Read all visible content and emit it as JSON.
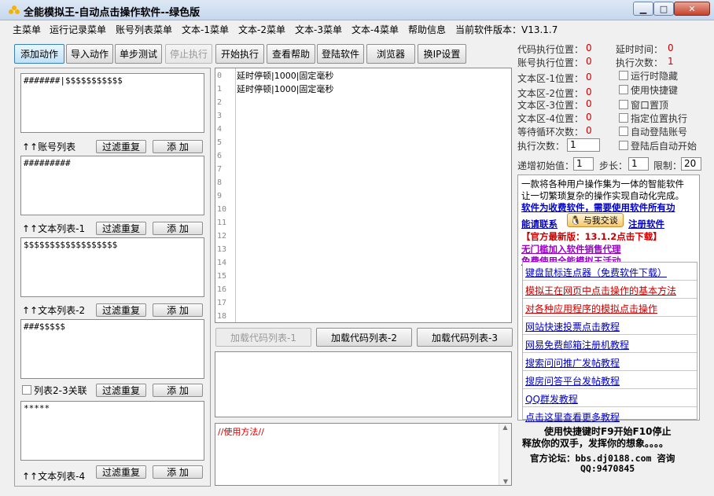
{
  "window": {
    "title": "全能模拟王-自动点击操作软件--绿色版"
  },
  "menus": [
    "主菜单",
    "运行记录菜单",
    "账号列表菜单",
    "文本-1菜单",
    "文本-2菜单",
    "文本-3菜单",
    "文本-4菜单",
    "帮助信息",
    "当前软件版本：V13.1.7"
  ],
  "toolbar": [
    "添加动作",
    "导入动作",
    "单步测试",
    "停止执行",
    "开始执行",
    "查看帮助",
    "登陆软件",
    "浏览器",
    "换IP设置"
  ],
  "left": {
    "box1": "#######|$$$$$$$$$$$",
    "box2": "#########",
    "box3": "$$$$$$$$$$$$$$$$$$",
    "box4": "###$$$$$",
    "box5": "*****",
    "label_account": "↑↑账号列表",
    "label_text1": "↑↑文本列表-1",
    "label_text2": "↑↑文本列表-2",
    "label_link": "列表2-3关联",
    "label_text4": "↑↑文本列表-4",
    "filter": "过滤重复",
    "add": "添 加"
  },
  "code": {
    "line_numbers": [
      "0",
      "1",
      "2",
      "3",
      "4",
      "5",
      "6",
      "7",
      "8",
      "9",
      "10",
      "11",
      "12",
      "13",
      "14",
      "15",
      "16",
      "17",
      "18"
    ],
    "lines": [
      "延时停顿|1000|固定毫秒",
      "延时停顿|1000|固定毫秒"
    ],
    "load1": "加载代码列表-1",
    "load2": "加载代码列表-2",
    "load3": "加载代码列表-3",
    "usage": "//使用方法//"
  },
  "status": {
    "code_pos_label": "代码执行位置：",
    "code_pos": "0",
    "delay_label": "延时时间：",
    "delay": "0",
    "account_pos_label": "账号执行位置：",
    "account_pos": "0",
    "exec_count_label": "执行次数：",
    "exec_count": "1",
    "t1_label": "文本区-1位置：",
    "t1": "0",
    "t2_label": "文本区-2位置：",
    "t2": "0",
    "t3_label": "文本区-3位置：",
    "t3": "0",
    "t4_label": "文本区-4位置：",
    "t4": "0",
    "wait_label": "等待循环次数：",
    "wait": "0",
    "exec_times_label": "执行次数：",
    "exec_times": "1",
    "inc_label": "递增初始值：",
    "inc": "1",
    "step_label": "步长：",
    "step": "1",
    "limit_label": "限制：",
    "limit": "20"
  },
  "options": [
    "运行时隐藏",
    "使用快捷键",
    "窗口置顶",
    "指定位置执行",
    "自动登陆账号",
    "登陆后自动开始"
  ],
  "info": {
    "desc1": "一款将各种用户操作集为一体的智能软件",
    "desc2": "让一切繁琐复杂的操作实现自动化完成。",
    "paid": "软件为收费软件，需要使用软件所有功",
    "contact": "能请联系",
    "qq_badge": "与我交谈",
    "register": "注册软件",
    "latest": "【官方最新版：13.1.2点击下载】",
    "agent": "无门槛加入软件销售代理",
    "free": "免费使用全能模拟王活动"
  },
  "links": [
    {
      "text": "键盘鼠标连点器（免费软件下载）",
      "color": "#0000cc"
    },
    {
      "text": "模拟王在网页中点击操作的基本方法",
      "color": "#cc0000"
    },
    {
      "text": "对各种应用程序的模拟点击操作",
      "color": "#cc0000"
    },
    {
      "text": "网站快速投票点击教程",
      "color": "#0000cc"
    },
    {
      "text": "网易免费邮箱注册机教程",
      "color": "#0000cc"
    },
    {
      "text": "搜索问问推广发帖教程",
      "color": "#0000cc"
    },
    {
      "text": "搜房问答平台发帖教程",
      "color": "#0000cc"
    },
    {
      "text": "QQ群发教程",
      "color": "#0000cc"
    },
    {
      "text": "点击这里查看更多教程",
      "color": "#0000cc"
    }
  ],
  "footer": {
    "hotkey": "使用快捷键时F9开始F10停止",
    "slogan": "释放你的双手，发挥你的想象。。。。",
    "forum": "官方论坛：bbs.dj0188.com  咨询",
    "qq": "QQ:9470845"
  },
  "colors": {
    "red": "#cc0000",
    "blue": "#0000cc",
    "purple": "#9900cc"
  }
}
